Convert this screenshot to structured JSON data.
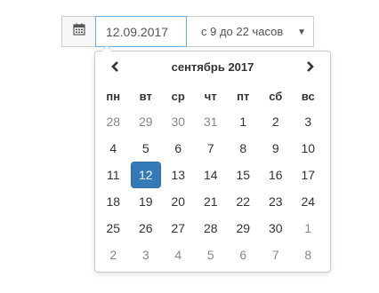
{
  "date_input": {
    "value": "12.09.2017",
    "icon": "calendar-icon"
  },
  "time_select": {
    "selected": "с 9 до 22 часов"
  },
  "picker": {
    "month_title": "сентябрь 2017",
    "prev_icon": "chevron-left-icon",
    "next_icon": "chevron-right-icon",
    "weekdays": [
      "пн",
      "вт",
      "ср",
      "чт",
      "пт",
      "сб",
      "вс"
    ],
    "weeks": [
      [
        {
          "d": "28",
          "m": true
        },
        {
          "d": "29",
          "m": true
        },
        {
          "d": "30",
          "m": true
        },
        {
          "d": "31",
          "m": true
        },
        {
          "d": "1"
        },
        {
          "d": "2"
        },
        {
          "d": "3"
        }
      ],
      [
        {
          "d": "4"
        },
        {
          "d": "5"
        },
        {
          "d": "6"
        },
        {
          "d": "7"
        },
        {
          "d": "8"
        },
        {
          "d": "9"
        },
        {
          "d": "10"
        }
      ],
      [
        {
          "d": "11"
        },
        {
          "d": "12",
          "active": true
        },
        {
          "d": "13"
        },
        {
          "d": "14"
        },
        {
          "d": "15"
        },
        {
          "d": "16"
        },
        {
          "d": "17"
        }
      ],
      [
        {
          "d": "18"
        },
        {
          "d": "19"
        },
        {
          "d": "20"
        },
        {
          "d": "21"
        },
        {
          "d": "22"
        },
        {
          "d": "23"
        },
        {
          "d": "24"
        }
      ],
      [
        {
          "d": "25"
        },
        {
          "d": "26"
        },
        {
          "d": "27"
        },
        {
          "d": "28"
        },
        {
          "d": "29"
        },
        {
          "d": "30"
        },
        {
          "d": "1",
          "m": true
        }
      ],
      [
        {
          "d": "2",
          "m": true
        },
        {
          "d": "3",
          "m": true
        },
        {
          "d": "4",
          "m": true
        },
        {
          "d": "5",
          "m": true
        },
        {
          "d": "6",
          "m": true
        },
        {
          "d": "7",
          "m": true
        },
        {
          "d": "8",
          "m": true
        }
      ]
    ],
    "active_color": "#337ab7",
    "muted_color": "#888888"
  }
}
